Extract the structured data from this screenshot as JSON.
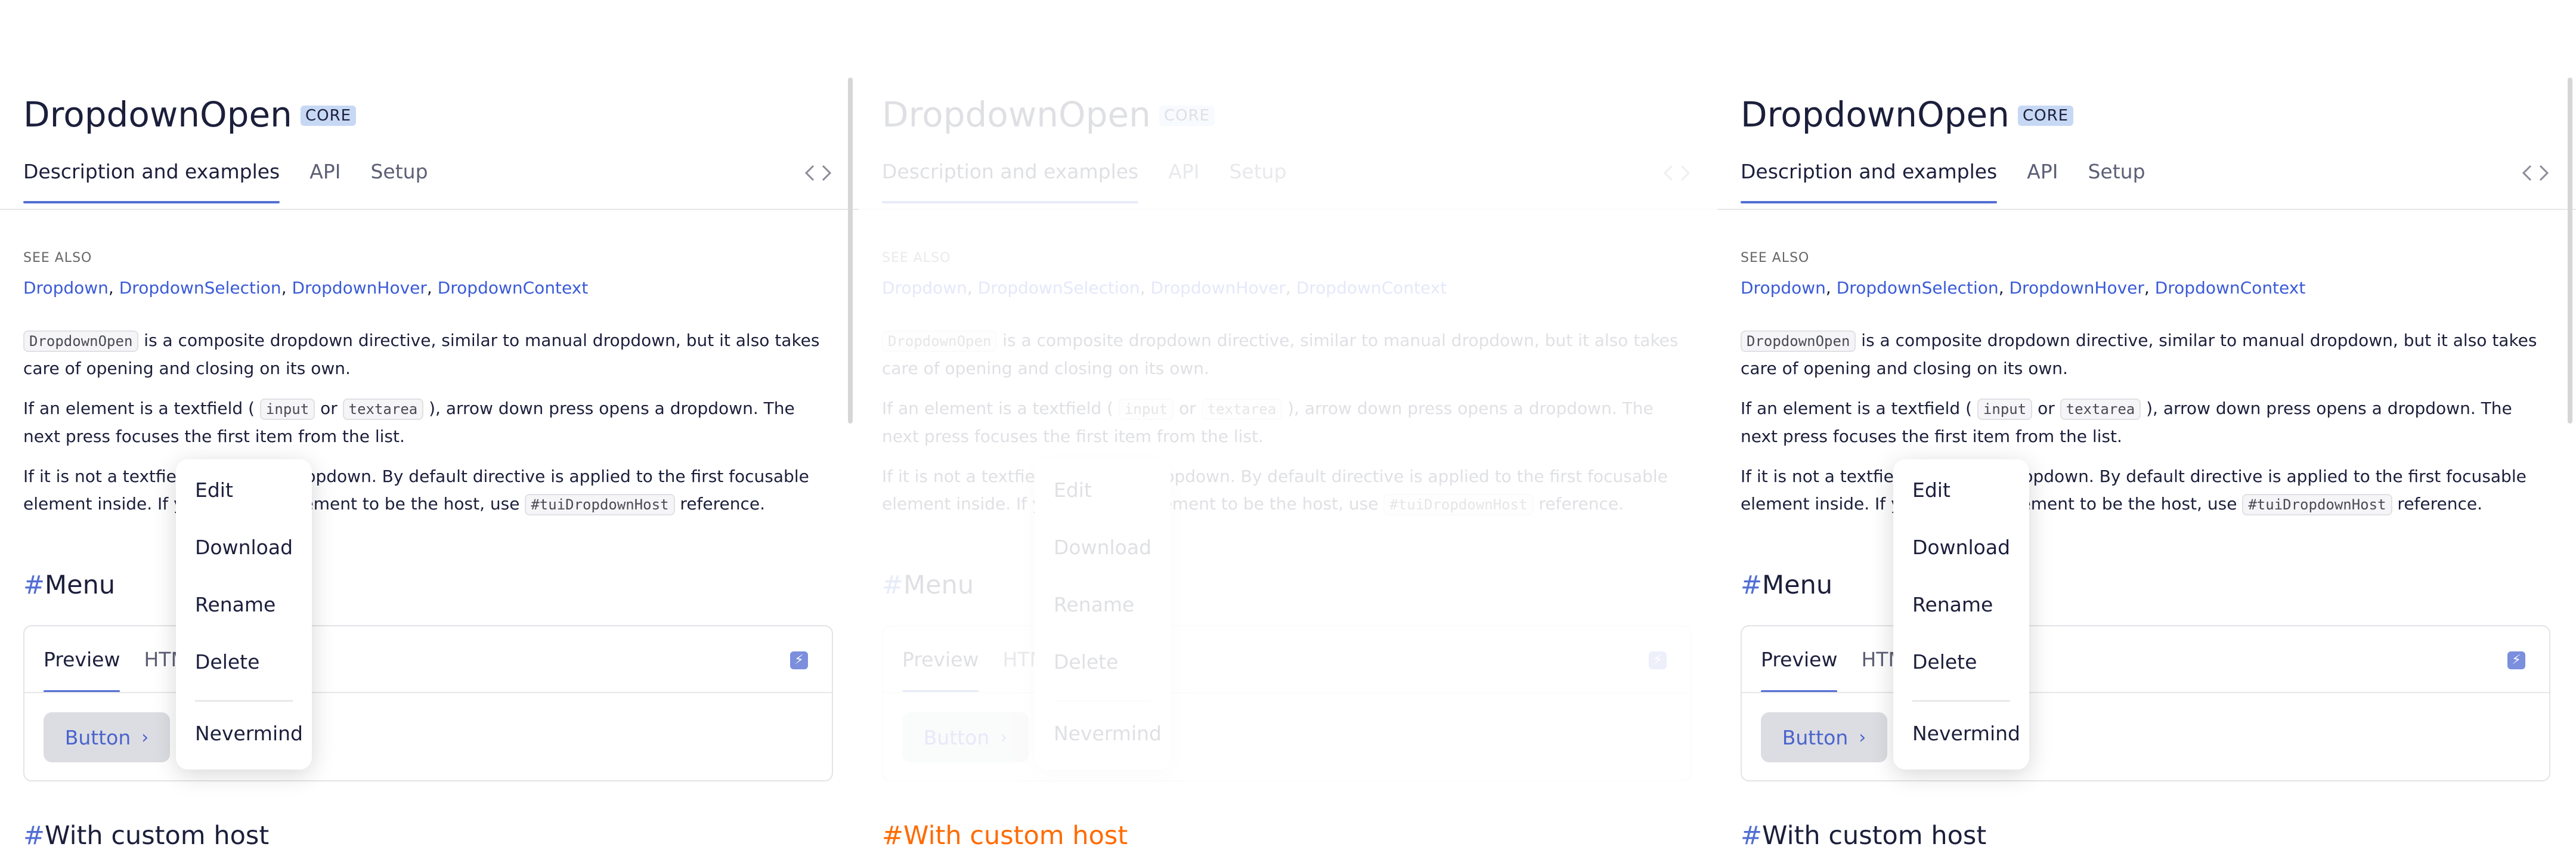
{
  "page": {
    "title": "DropdownOpen",
    "badge": "CORE",
    "tabs": [
      "Description and examples",
      "API",
      "Setup"
    ],
    "see_also_label": "SEE ALSO",
    "see_also_links": [
      "Dropdown",
      "DropdownSelection",
      "DropdownHover",
      "DropdownContext"
    ],
    "link_separator": ", ",
    "para1_code": "DropdownOpen",
    "para1_text": " is a composite dropdown directive, similar to manual dropdown, but it also takes care of opening and closing on its own.",
    "para2_a": "If an element is a textfield ( ",
    "para2_code1": "input",
    "para2_b": " or ",
    "para2_code2": "textarea",
    "para2_c": " ), arrow down press opens a dropdown. The next press focuses the first item from the list.",
    "para3_a": "If it is not a textfield,",
    "para3_b": "ses a dropdown. By default directive is applied to the first focusable element inside. If you",
    "para3_c": "ement to be the host, use ",
    "para3_code": "#tuiDropdownHost",
    "para3_d": " reference.",
    "section_menu": "Menu",
    "hash": "#",
    "example_tabs": [
      "Preview",
      "HTM",
      "t"
    ],
    "button_label": "Button",
    "chevron": "›",
    "bolt": "⚡",
    "dropdown_items": [
      "Edit",
      "Download",
      "Rename",
      "Delete",
      "Nevermind"
    ],
    "section_custom_host": "With custom host"
  },
  "colors": {
    "accent": "#526ed3",
    "link": "#3a5bd8",
    "text": "#1b1f3b",
    "orange": "#ff6b00",
    "badge_bg": "#c7d8f5"
  }
}
